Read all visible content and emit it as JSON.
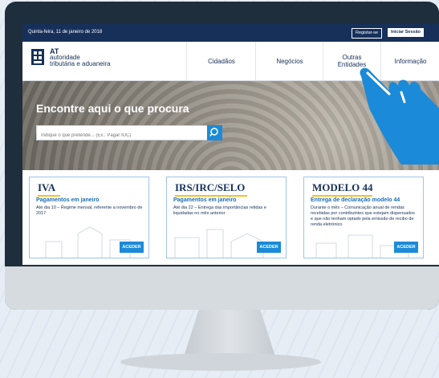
{
  "topbar": {
    "date": "Quinta-feira, 11 de janeiro de 2018",
    "register_label": "Registar-se",
    "login_label": "Iniciar Sessão"
  },
  "logo": {
    "line1": "AT",
    "line2": "autoridade",
    "line3": "tributária e aduaneira"
  },
  "nav": {
    "items": [
      {
        "label": "Cidadãos"
      },
      {
        "label": "Negócios"
      },
      {
        "label": "Outras Entidades"
      },
      {
        "label": "Informação"
      }
    ]
  },
  "hero": {
    "title": "Encontre aqui o que procura",
    "search_placeholder": "Indique o que pretende... (Ex.: Pagar IUC)"
  },
  "cards": [
    {
      "title": "IVA",
      "subtitle": "Pagamentos em janeiro",
      "description": "Até dia 10 – Regime mensal, referente a novembro de 2017",
      "button": "ACEDER"
    },
    {
      "title": "IRS/IRC/SELO",
      "subtitle": "Pagamentos em janeiro",
      "description": "Até dia 22 – Entrega das importâncias retidas e liquidadas no mês anterior",
      "button": "ACEDER"
    },
    {
      "title": "MODELO 44",
      "subtitle": "Entrega de declaração modelo 44",
      "description": "Durante o mês – Comunicação anual de rendas recebidas por contribuintes que estejam dispensados e que não tenham optado pela emissão de recibo de renda eletrónico",
      "button": "ACEDER"
    }
  ],
  "colors": {
    "navy": "#16305a",
    "accent_blue": "#1b8ad8",
    "yellow": "#f4c21b"
  }
}
